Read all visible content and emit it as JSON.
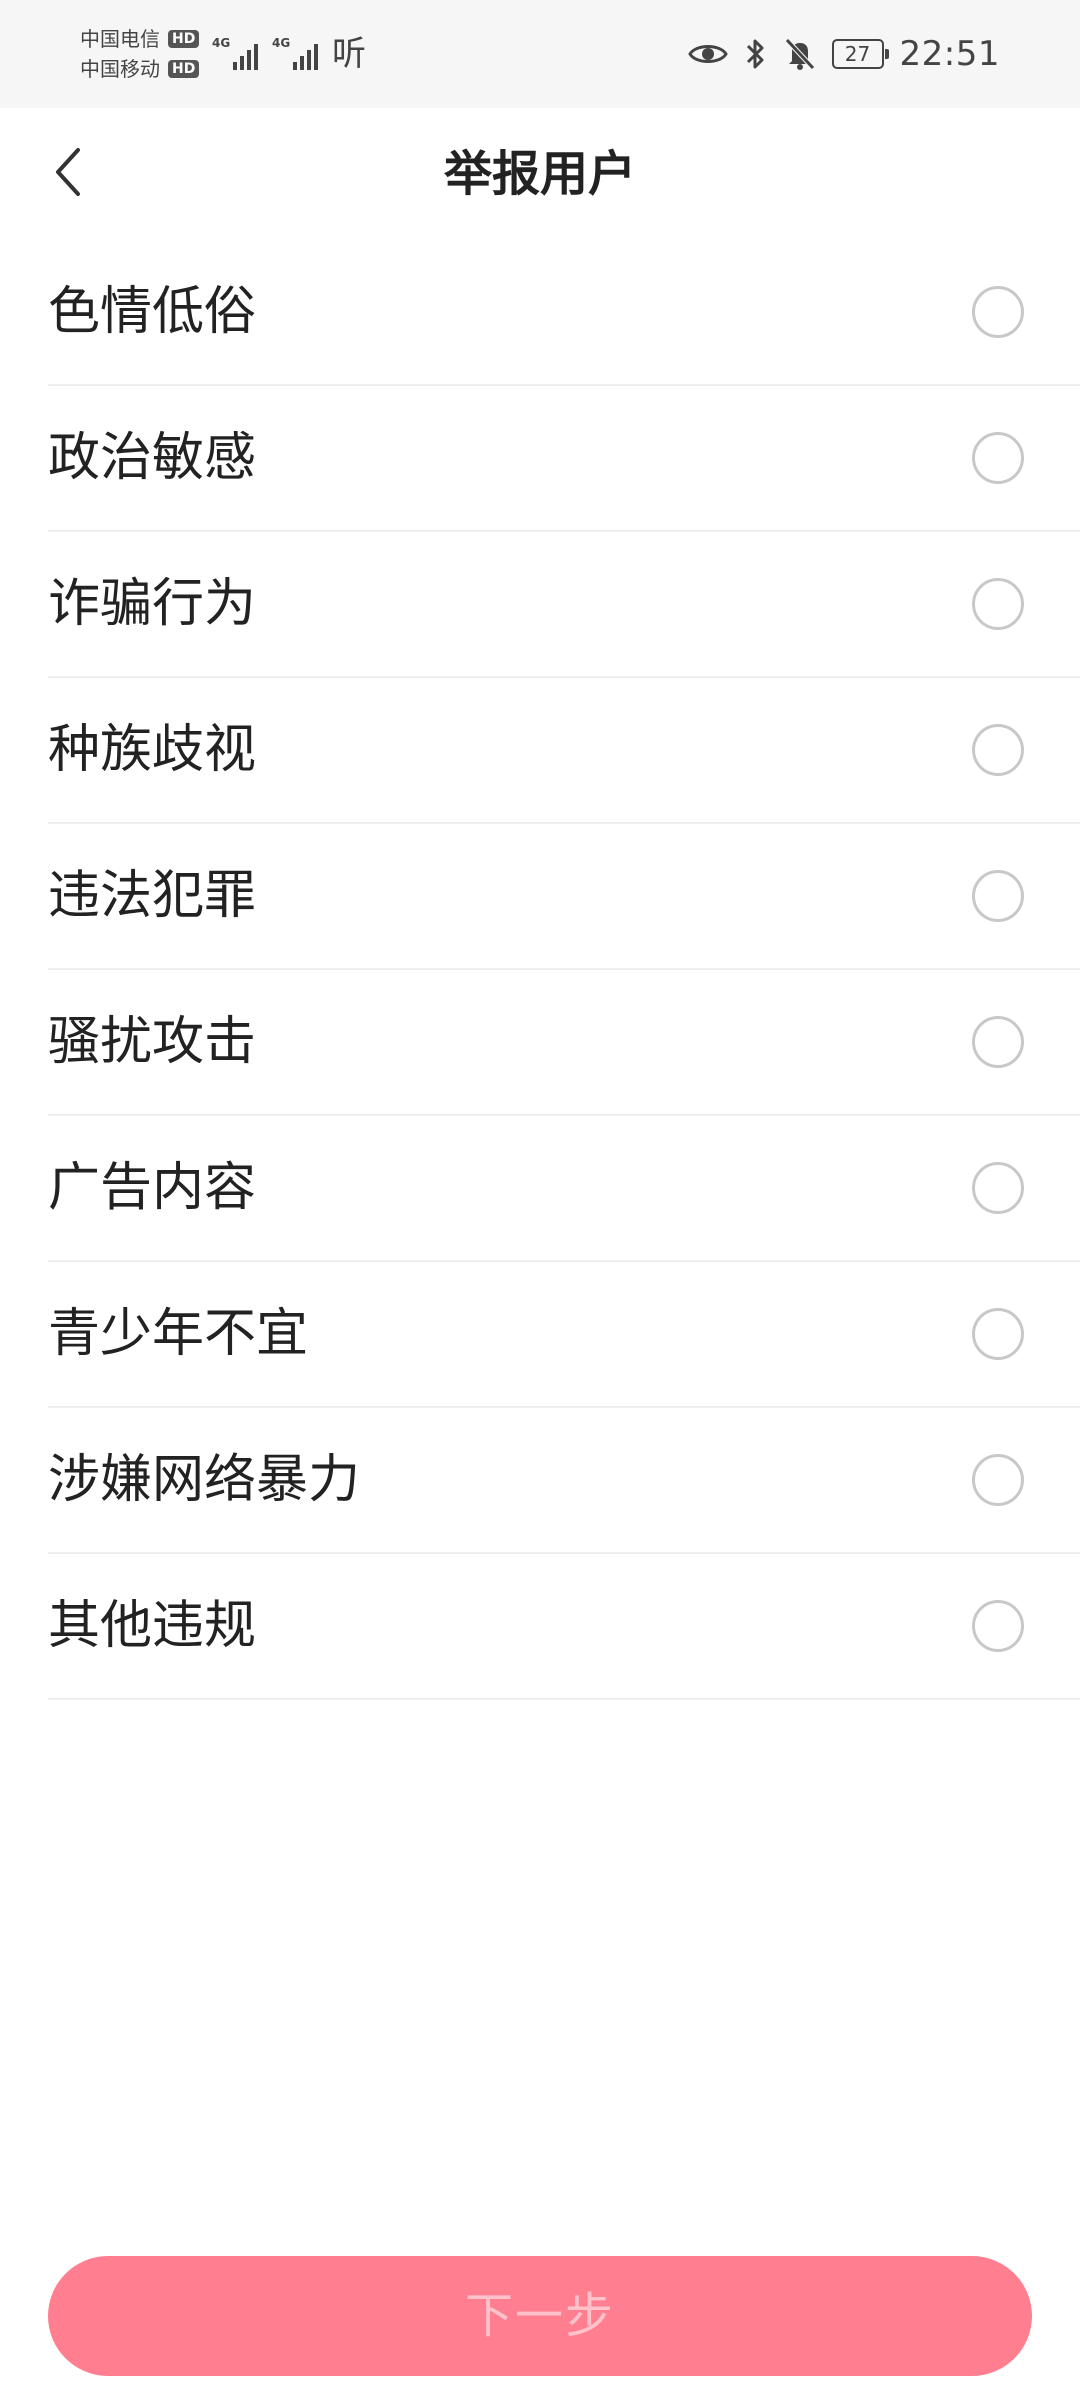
{
  "status_bar": {
    "carrier_1": "中国电信",
    "carrier_2": "中国移动",
    "hd_badge": "HD",
    "signal_1_tag": "4G",
    "signal_2_tag": "4G",
    "network_label": "听",
    "battery": "27",
    "time": "22:51",
    "icons": [
      "eye-icon",
      "bluetooth-icon",
      "bell-muted-icon",
      "battery-icon"
    ]
  },
  "nav": {
    "title": "举报用户",
    "back_icon": "chevron-left-icon"
  },
  "options": [
    {
      "label": "色情低俗",
      "selected": false
    },
    {
      "label": "政治敏感",
      "selected": false
    },
    {
      "label": "诈骗行为",
      "selected": false
    },
    {
      "label": "种族歧视",
      "selected": false
    },
    {
      "label": "违法犯罪",
      "selected": false
    },
    {
      "label": "骚扰攻击",
      "selected": false
    },
    {
      "label": "广告内容",
      "selected": false
    },
    {
      "label": "青少年不宜",
      "selected": false
    },
    {
      "label": "涉嫌网络暴力",
      "selected": false
    },
    {
      "label": "其他违规",
      "selected": false
    }
  ],
  "footer": {
    "next_label": "下一步",
    "button_color": "#ff7f90"
  }
}
